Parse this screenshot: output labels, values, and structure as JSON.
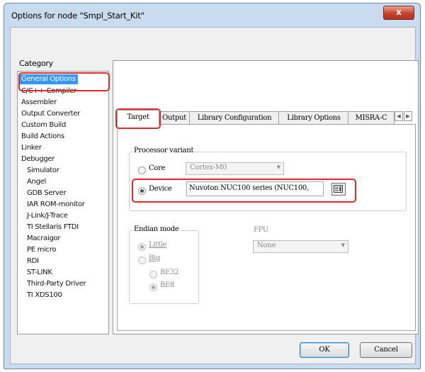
{
  "window": {
    "title": "Options for node \"Smpl_Start_Kit\"",
    "close_label": "x"
  },
  "category": {
    "label": "Category",
    "items": [
      "General Options",
      "C/C++ Compiler",
      "Assembler",
      "Output Converter",
      "Custom Build",
      "Build Actions",
      "Linker",
      "Debugger",
      "Simulator",
      "Angel",
      "GDB Server",
      "IAR ROM-monitor",
      "J-Link/J-Trace",
      "TI Stellaris FTDI",
      "Macraigor",
      "PE micro",
      "RDI",
      "ST-LINK",
      "Third-Party Driver",
      "TI XDS100"
    ],
    "selected": "General Options"
  },
  "tabs": [
    "Target",
    "Output",
    "Library Configuration",
    "Library Options",
    "MISRA-C"
  ],
  "active_tab": "Target",
  "processor": {
    "group_title": "Processor variant",
    "core_label": "Core",
    "core_value": "Cortex-M0",
    "device_label": "Device",
    "device_value": "Nuvoton NUC100 series (NUC100,",
    "selected": "Device"
  },
  "endian": {
    "group_title": "Endian mode",
    "little_label": "Little",
    "big_label": "Big",
    "be32_label": "BE32",
    "be8_label": "BE8",
    "selected": "Little",
    "big_selected": "BE8"
  },
  "fpu": {
    "label": "FPU",
    "value": "None"
  },
  "buttons": {
    "ok": "OK",
    "cancel": "Cancel"
  },
  "colors": {
    "selection": "#3399ff",
    "highlight": "#e0282c",
    "close_button": "#c7442c"
  }
}
